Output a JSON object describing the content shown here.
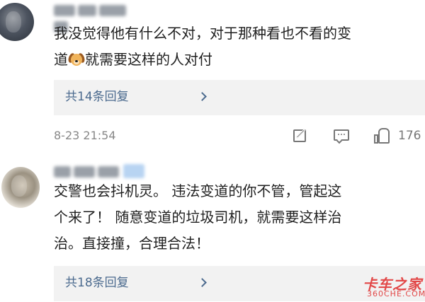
{
  "comments": [
    {
      "text_lines": [
        "我没觉得他有什么不对，对于那种看也不看的变",
        "道",
        "就需要这样的人对付"
      ],
      "emoji": "dog-face",
      "replies_label": "共14条回复",
      "timestamp": "8-23 21:54",
      "like_count": "176"
    },
    {
      "text_lines": [
        "交警也会抖机灵。  违法变道的你不管，管起这",
        "个来了！   随意变道的垃圾司机，就需要这样治",
        "治。直接撞，合理合法！"
      ],
      "replies_label": "共18条回复"
    }
  ],
  "watermark": {
    "logo": "卡车之家",
    "url": "360CHE.COM"
  },
  "colors": {
    "link": "#4b6a8e",
    "reply_bg": "#f2f2f2",
    "watermark": "#e24848"
  }
}
